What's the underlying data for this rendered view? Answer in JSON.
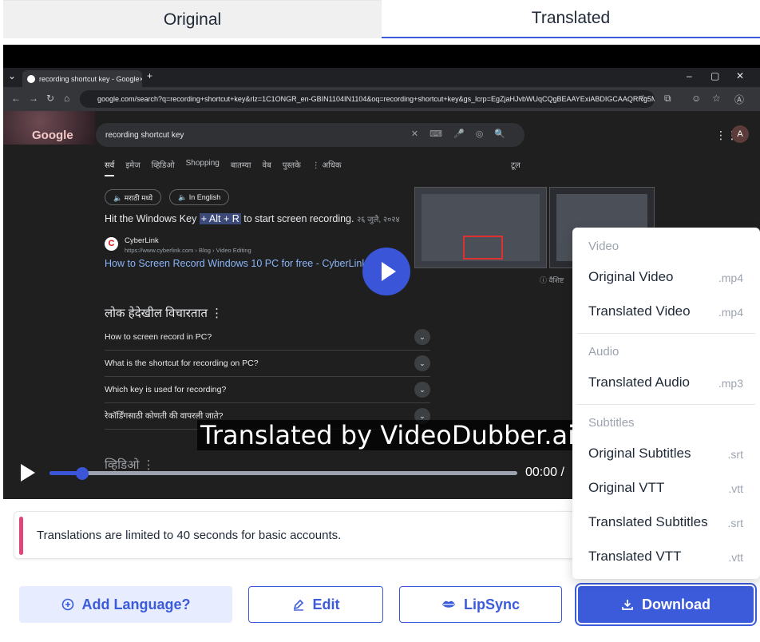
{
  "tabs": {
    "original": "Original",
    "translated": "Translated"
  },
  "browser": {
    "tab_title": "recording shortcut key - Google",
    "url": "google.com/search?q=recording+shortcut+key&rlz=1C1ONGR_en-GBIN1104IN1104&oq=recording+shortcut+key&gs_lcrp=EgZjaHJvbWUqCQgBEAAYExiABDIGCAAQRRg5MgkIARA...",
    "search_query": "recording shortcut key",
    "avatar": "A",
    "nav_tabs": [
      "सर्व",
      "इमेज",
      "व्हिडिओ",
      "Shopping",
      "बातम्या",
      "वेब",
      "पुस्तके",
      "⋮ अधिक"
    ],
    "tools": "टूल",
    "chip_marathi": "🔈 मराठी मध्ये",
    "chip_english": "🔈 In English",
    "snippet_pre": "Hit the Windows Key ",
    "snippet_hl": "+ Alt + R",
    "snippet_post": " to start screen recording.",
    "snippet_date": "२६ जुलै, २०२४",
    "site_name": "CyberLink",
    "site_url": "https://www.cyberlink.com › Blog › Video Editing",
    "result_link": "How to Screen Record Windows 10 PC for free - CyberLink",
    "feedback": "वैशिष्ट",
    "paa_title": "लोक हेदेखील विचारतात  ⋮",
    "questions": [
      "How to screen record in PC?",
      "What is the shortcut for recording on PC?",
      "Which key is used for recording?",
      "रेकॉर्डिंगसाठी कोणती की वापरली जाते?"
    ],
    "videos_heading": "व्हिडिओ  ⋮"
  },
  "player": {
    "caption": "Translated by VideoDubber.ai",
    "time": "00:00 /",
    "progress": 0.07
  },
  "notice": "Translations are limited to 40 seconds for basic accounts.",
  "buttons": {
    "add_language": "Add Language?",
    "edit": "Edit",
    "lipsync": "LipSync",
    "download": "Download"
  },
  "download_menu": {
    "video_header": "Video",
    "original_video": "Original Video",
    "original_video_ext": ".mp4",
    "translated_video": "Translated Video",
    "translated_video_ext": ".mp4",
    "audio_header": "Audio",
    "translated_audio": "Translated Audio",
    "translated_audio_ext": ".mp3",
    "subtitles_header": "Subtitles",
    "original_subtitles": "Original Subtitles",
    "original_subtitles_ext": ".srt",
    "original_vtt": "Original VTT",
    "original_vtt_ext": ".vtt",
    "translated_subtitles": "Translated Subtitles",
    "translated_subtitles_ext": ".srt",
    "translated_vtt": "Translated VTT",
    "translated_vtt_ext": ".vtt"
  },
  "colors": {
    "accent": "#3b5bdb",
    "notice_bar": "#e0467c",
    "menu_muted": "#9ca3af"
  }
}
